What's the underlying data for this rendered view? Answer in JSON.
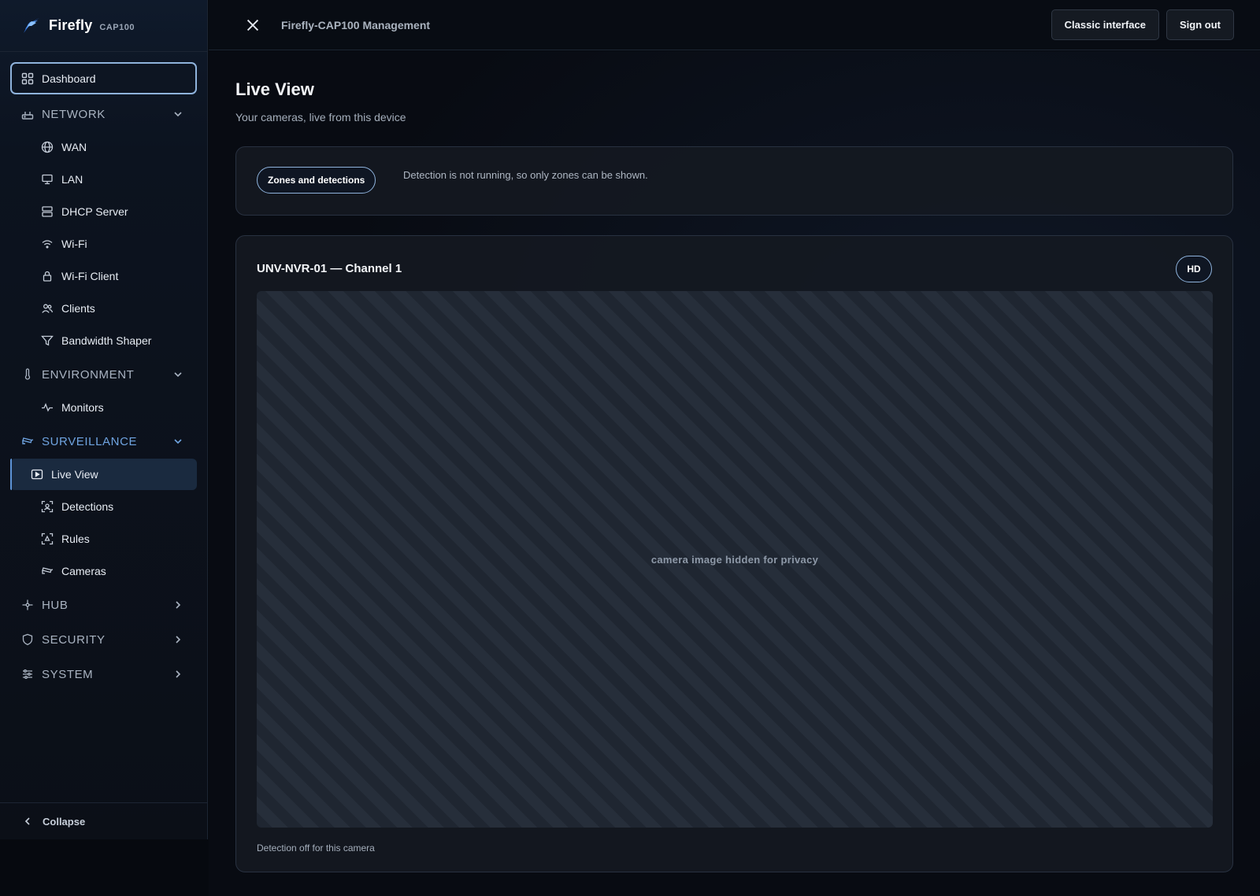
{
  "brand": {
    "name": "Firefly",
    "model": "CAP100"
  },
  "topbar": {
    "title": "Firefly-CAP100 Management",
    "classic_label": "Classic interface",
    "signout_label": "Sign out"
  },
  "sidebar": {
    "dashboard": "Dashboard",
    "network": {
      "label": "NETWORK",
      "items": [
        "WAN",
        "LAN",
        "DHCP Server",
        "Wi-Fi",
        "Wi-Fi Client",
        "Clients",
        "Bandwidth Shaper"
      ]
    },
    "environment": {
      "label": "ENVIRONMENT",
      "items": [
        "Monitors"
      ]
    },
    "surveillance": {
      "label": "SURVEILLANCE",
      "items": [
        "Live View",
        "Detections",
        "Rules",
        "Cameras"
      ]
    },
    "hub": "HUB",
    "security": "SECURITY",
    "system": "SYSTEM",
    "collapse": "Collapse"
  },
  "page": {
    "title": "Live View",
    "subtitle": "Your cameras, live from this device"
  },
  "zones": {
    "button": "Zones and detections",
    "note": "Detection is not running, so only zones can be shown."
  },
  "camera": {
    "title": "UNV-NVR-01 — Channel 1",
    "quality": "HD",
    "hidden_text": "camera image hidden for privacy",
    "footer": "Detection off for this camera"
  },
  "colors": {
    "accent": "#8fb3dc",
    "active_section": "#6fa3e0"
  }
}
